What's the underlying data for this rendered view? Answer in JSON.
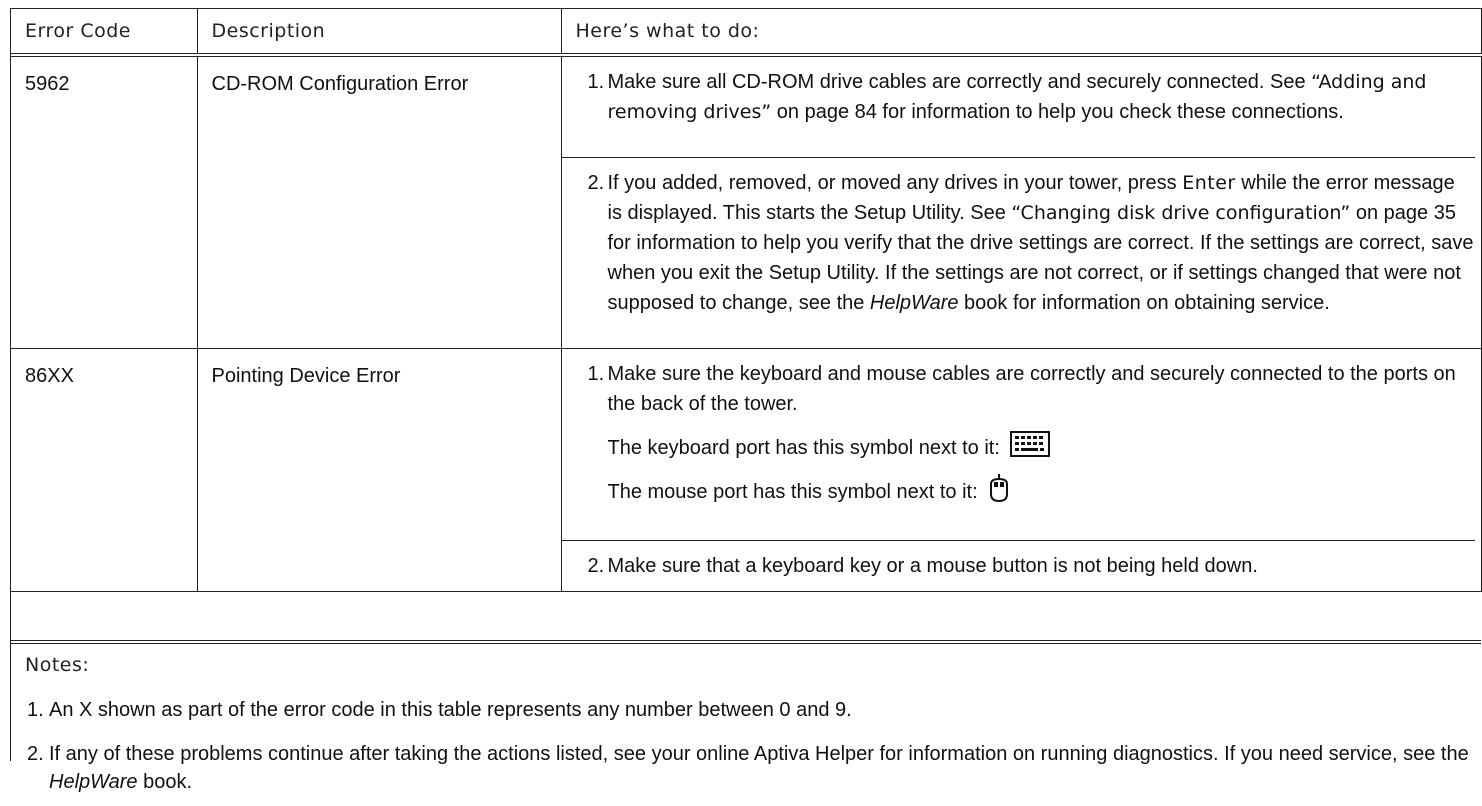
{
  "table": {
    "headers": {
      "code": "Error Code",
      "description": "Description",
      "action": "Here’s what to do:"
    },
    "rows": [
      {
        "code": "5962",
        "description": "CD-ROM Configuration Error",
        "steps": [
          {
            "num": "1.",
            "text_a": "Make sure all CD-ROM drive cables are correctly and securely connected. See ",
            "ref": "“Adding and removing drives”",
            "text_b": " on page 84 for information to help you check these connections."
          },
          {
            "num": "2.",
            "text_a": "If you added, removed, or moved any drives in your tower, press ",
            "key": "Enter",
            "text_b": " while the error message is displayed. This starts the Setup Utility. See ",
            "ref": "“Changing disk drive configuration”",
            "text_c": " on page 35 for information to help you verify that the drive settings are correct. If the settings are correct, save when you exit the Setup Utility. If the settings are not correct, or if settings changed that were not supposed to change, see the ",
            "book": "HelpWare",
            "text_d": " book for information on obtaining service."
          }
        ]
      },
      {
        "code": "86XX",
        "description": "Pointing Device Error",
        "steps": [
          {
            "num": "1.",
            "text": "Make sure the keyboard and mouse cables are correctly and securely connected to the ports on the back of the tower.",
            "keyboard_line": "The keyboard port has this symbol next to it:",
            "keyboard_icon": "keyboard-icon",
            "mouse_line": "The mouse port has this symbol next to it:",
            "mouse_icon": "mouse-icon"
          },
          {
            "num": "2.",
            "text": "Make sure that a keyboard key or a mouse button is not being held down."
          }
        ]
      }
    ]
  },
  "notes": {
    "title": "Notes:",
    "items": [
      {
        "num": "1.",
        "text": "An X shown as part of the error code in this table represents any number between 0 and 9."
      },
      {
        "num": "2.",
        "text_a": "If any of these problems continue after taking the actions listed, see your online Aptiva Helper for information on running diagnostics. If you need service, see the ",
        "book": "HelpWare",
        "text_b": " book."
      }
    ]
  }
}
